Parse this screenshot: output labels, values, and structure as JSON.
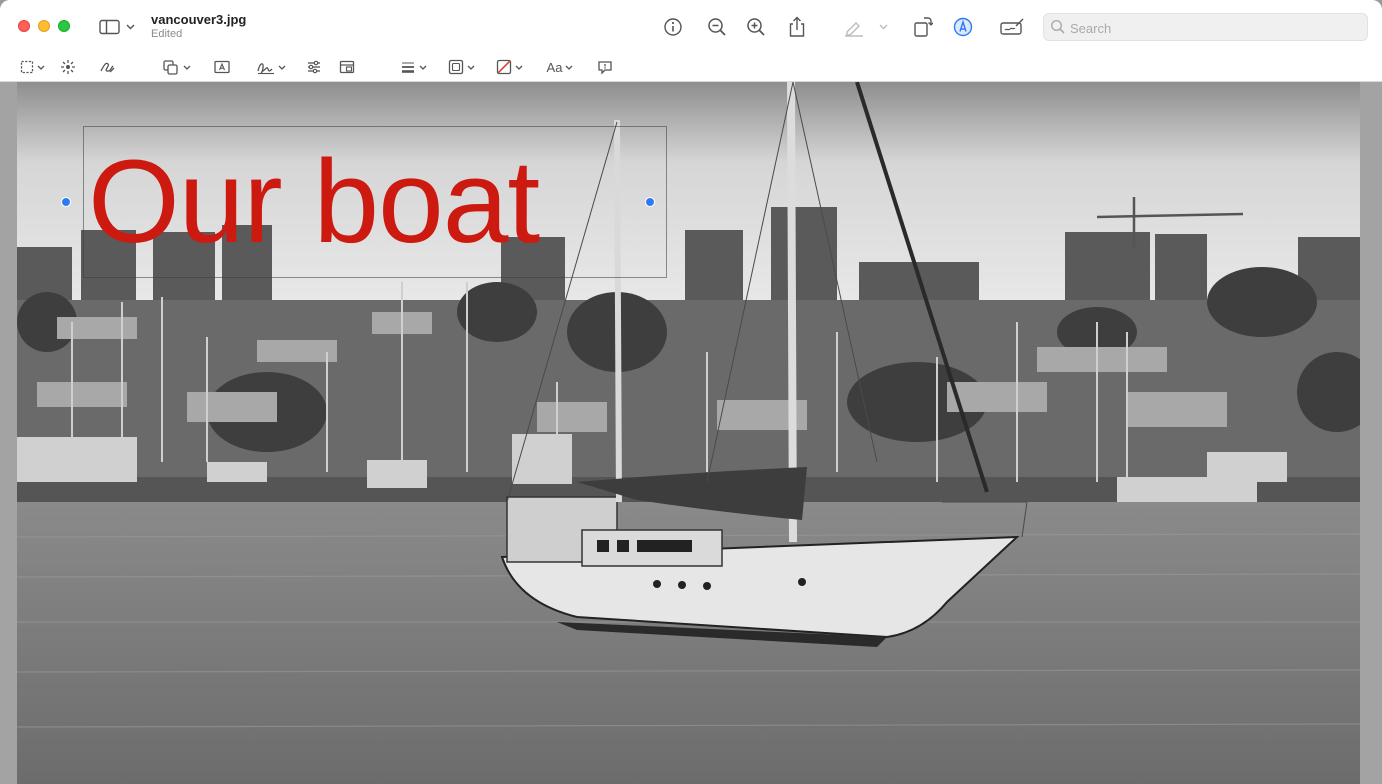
{
  "window": {
    "file_name": "vancouver3.jpg",
    "status": "Edited"
  },
  "toolbar": {
    "sidebar_toggle": "sidebar-icon",
    "info": "info-icon",
    "zoom_out": "zoom-out-icon",
    "zoom_in": "zoom-in-icon",
    "share": "share-icon",
    "highlight": "highlighter-icon",
    "rotate": "rotate-icon",
    "markup": "markup-icon",
    "annotate": "signature-pad-icon"
  },
  "search": {
    "placeholder": "Search",
    "value": ""
  },
  "markup_toolbar": {
    "items": [
      "rectangular-selection-icon",
      "instant-alpha-icon",
      "sketch-icon",
      "shapes-icon",
      "text-icon",
      "sign-icon",
      "adjust-color-icon",
      "adjust-size-icon",
      "shape-style-icon",
      "border-color-icon",
      "fill-color-icon",
      "text-style-icon",
      "note-icon"
    ],
    "text_style_label": "Aa"
  },
  "annotation": {
    "text": "Our boat",
    "color": "#cc1a10",
    "handle_color": "#2f7bf5"
  },
  "colors": {
    "accent": "#2f7bf5",
    "close": "#fe5f57",
    "minimize": "#febc2e",
    "zoom": "#28c840"
  }
}
